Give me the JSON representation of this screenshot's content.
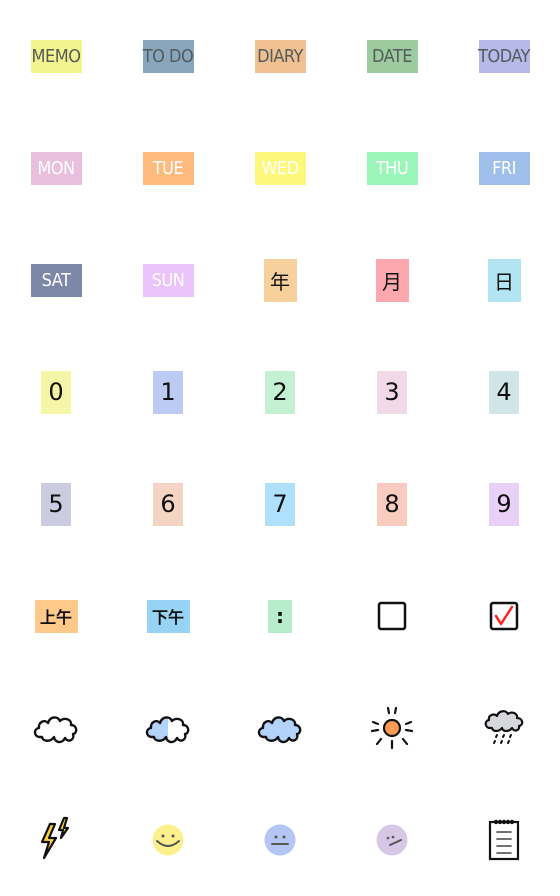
{
  "sticker_sheet": {
    "rows": [
      {
        "name": "labels",
        "items": [
          {
            "label": "MEMO",
            "bg": "#f2f58e",
            "text": "#555a5a"
          },
          {
            "label": "TO DO",
            "bg": "#88a7bf",
            "text": "#555a5a"
          },
          {
            "label": "DIARY",
            "bg": "#efc090",
            "text": "#555a5a"
          },
          {
            "label": "DATE",
            "bg": "#9bcb9e",
            "text": "#555a5a"
          },
          {
            "label": "TODAY",
            "bg": "#b7b9ea",
            "text": "#555a5a"
          }
        ]
      },
      {
        "name": "weekdays",
        "items": [
          {
            "label": "MON",
            "bg": "#e8bfdc",
            "text": "#ffffff"
          },
          {
            "label": "TUE",
            "bg": "#ffbb7d",
            "text": "#ffffff"
          },
          {
            "label": "WED",
            "bg": "#fdf77a",
            "text": "#ffffff"
          },
          {
            "label": "THU",
            "bg": "#9bf7b9",
            "text": "#ffffff"
          },
          {
            "label": "FRI",
            "bg": "#9fbfea",
            "text": "#ffffff"
          }
        ]
      },
      {
        "name": "weekend-and-date-units",
        "items": [
          {
            "label": "SAT",
            "bg": "#7d87a8",
            "text": "#ffffff"
          },
          {
            "label": "SUN",
            "bg": "#e9c3f9",
            "text": "#ffffff"
          },
          {
            "label": "年",
            "bg": "#f6d19c",
            "text": "#111111"
          },
          {
            "label": "月",
            "bg": "#fca8ae",
            "text": "#111111"
          },
          {
            "label": "日",
            "bg": "#b2e4f1",
            "text": "#111111"
          }
        ]
      },
      {
        "name": "digits-0-4",
        "items": [
          {
            "label": "0",
            "bg": "#f5f6a7"
          },
          {
            "label": "1",
            "bg": "#bccbf3"
          },
          {
            "label": "2",
            "bg": "#c4f1d1"
          },
          {
            "label": "3",
            "bg": "#f1d9e8"
          },
          {
            "label": "4",
            "bg": "#cfe5e8"
          }
        ]
      },
      {
        "name": "digits-5-9",
        "items": [
          {
            "label": "5",
            "bg": "#cbcce0"
          },
          {
            "label": "6",
            "bg": "#f4d4c2"
          },
          {
            "label": "7",
            "bg": "#afe1fd"
          },
          {
            "label": "8",
            "bg": "#f9ccc0"
          },
          {
            "label": "9",
            "bg": "#e8d0f6"
          }
        ]
      },
      {
        "name": "time-and-checkboxes",
        "items": [
          {
            "label": "上午",
            "bg": "#ffc98a"
          },
          {
            "label": "下午",
            "bg": "#96d3f4"
          },
          {
            "label": ":",
            "bg": "#b7edcb"
          },
          {
            "icon": "empty-checkbox-icon"
          },
          {
            "icon": "checked-checkbox-icon",
            "check_color": "#ff2020"
          }
        ]
      },
      {
        "name": "weather",
        "items": [
          {
            "icon": "cloud-outline-icon"
          },
          {
            "icon": "half-filled-cloud-icon",
            "fill": "#b3d3fb"
          },
          {
            "icon": "filled-cloud-icon",
            "fill": "#b3d3fb"
          },
          {
            "icon": "sun-icon",
            "fill": "#ff9a55"
          },
          {
            "icon": "rain-cloud-icon",
            "fill": "#d7d8dc"
          }
        ]
      },
      {
        "name": "misc",
        "items": [
          {
            "icon": "lightning-icon",
            "fill": "#ffd23a"
          },
          {
            "icon": "smiley-face-icon",
            "fill": "#fbf08c"
          },
          {
            "icon": "neutral-face-icon",
            "fill": "#b3c6f4"
          },
          {
            "icon": "skeptical-face-icon",
            "fill": "#d7c6e6"
          },
          {
            "icon": "notepad-icon"
          }
        ]
      }
    ]
  }
}
